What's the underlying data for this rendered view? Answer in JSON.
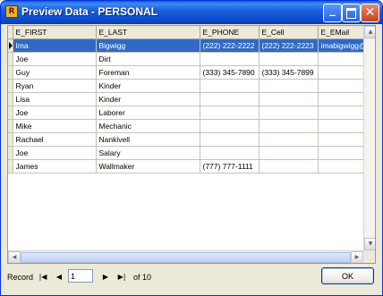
{
  "window": {
    "title": "Preview Data - PERSONAL",
    "app_icon_glyph": "R"
  },
  "grid": {
    "columns": [
      "E_FIRST",
      "E_LAST",
      "E_PHONE",
      "E_Cell",
      "E_EMail"
    ],
    "rows": [
      [
        "Ima",
        "Bigwigg",
        "(222) 222-2222",
        "(222) 222-2223",
        "imabigwigg@"
      ],
      [
        "Joe",
        "Dirt",
        "",
        "",
        ""
      ],
      [
        "Guy",
        "Foreman",
        "(333) 345-7890",
        "(333) 345-7899",
        ""
      ],
      [
        "Ryan",
        "Kinder",
        "",
        "",
        ""
      ],
      [
        "Lisa",
        "Kinder",
        "",
        "",
        ""
      ],
      [
        "Joe",
        "Laborer",
        "",
        "",
        ""
      ],
      [
        "Mike",
        "Mechanic",
        "",
        "",
        ""
      ],
      [
        "Rachael",
        "Nankivell",
        "",
        "",
        ""
      ],
      [
        "Joe",
        "Salary",
        "",
        "",
        ""
      ],
      [
        "James",
        "Wallmaker",
        "(777) 777-1111",
        "",
        ""
      ]
    ],
    "selected_row": 0
  },
  "navigator": {
    "label": "Record",
    "current": "1",
    "total_text": "of 10"
  },
  "ok_label": "OK"
}
